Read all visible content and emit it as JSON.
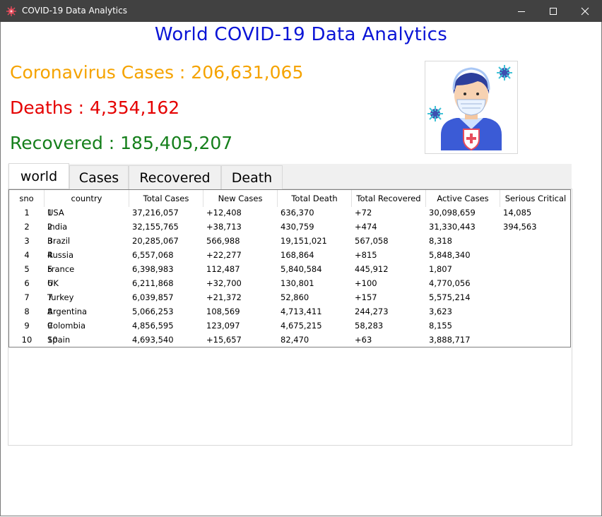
{
  "window": {
    "title": "COVID-19 Data Analytics",
    "icon": "virus-icon",
    "controls": [
      "minimize-icon",
      "maximize-icon",
      "close-icon"
    ]
  },
  "header": {
    "title": "World COVID-19 Data Analytics"
  },
  "stats": {
    "cases_text": "Coronavirus Cases : 206,631,065",
    "deaths_text": "Deaths : 4,354,162",
    "recovered_text": "Recovered : 185,405,207"
  },
  "image": {
    "icon": "masked-person-icon"
  },
  "tabs": [
    {
      "label": "world"
    },
    {
      "label": "Cases"
    },
    {
      "label": "Recovered"
    },
    {
      "label": "Death"
    }
  ],
  "table": {
    "columns": [
      "sno",
      "country",
      "Total Cases",
      "New Cases",
      "Total Death",
      "Total Recovered",
      "Active Cases",
      "Serious Critical"
    ],
    "rows": [
      {
        "index": "1",
        "sno": "1",
        "country": "USA",
        "total_cases": "37,216,057",
        "new_cases": "+12,408",
        "total_death": "636,370",
        "total_recovered": "+72",
        "active_cases": "30,098,659",
        "serious_critical": "14,085"
      },
      {
        "index": "2",
        "sno": "2",
        "country": "India",
        "total_cases": "32,155,765",
        "new_cases": "+38,713",
        "total_death": "430,759",
        "total_recovered": "+474",
        "active_cases": "31,330,443",
        "serious_critical": "394,563"
      },
      {
        "index": "3",
        "sno": "3",
        "country": "Brazil",
        "total_cases": "20,285,067",
        "new_cases": "566,988",
        "total_death": "19,151,021",
        "total_recovered": "567,058",
        "active_cases": "8,318",
        "serious_critical": ""
      },
      {
        "index": "4",
        "sno": "4",
        "country": "Russia",
        "total_cases": "6,557,068",
        "new_cases": "+22,277",
        "total_death": "168,864",
        "total_recovered": "+815",
        "active_cases": "5,848,340",
        "serious_critical": ""
      },
      {
        "index": "5",
        "sno": "5",
        "country": "France",
        "total_cases": "6,398,983",
        "new_cases": "112,487",
        "total_death": "5,840,584",
        "total_recovered": "445,912",
        "active_cases": "1,807",
        "serious_critical": ""
      },
      {
        "index": "6",
        "sno": "6",
        "country": "UK",
        "total_cases": "6,211,868",
        "new_cases": "+32,700",
        "total_death": "130,801",
        "total_recovered": "+100",
        "active_cases": "4,770,056",
        "serious_critical": ""
      },
      {
        "index": "7",
        "sno": "7",
        "country": "Turkey",
        "total_cases": "6,039,857",
        "new_cases": "+21,372",
        "total_death": "52,860",
        "total_recovered": "+157",
        "active_cases": "5,575,214",
        "serious_critical": ""
      },
      {
        "index": "8",
        "sno": "8",
        "country": "Argentina",
        "total_cases": "5,066,253",
        "new_cases": "108,569",
        "total_death": "4,713,411",
        "total_recovered": "244,273",
        "active_cases": "3,623",
        "serious_critical": ""
      },
      {
        "index": "9",
        "sno": "9",
        "country": "Colombia",
        "total_cases": "4,856,595",
        "new_cases": "123,097",
        "total_death": "4,675,215",
        "total_recovered": "58,283",
        "active_cases": "8,155",
        "serious_critical": ""
      },
      {
        "index": "10",
        "sno": "10",
        "country": "Spain",
        "total_cases": "4,693,540",
        "new_cases": "+15,657",
        "total_death": "82,470",
        "total_recovered": "+63",
        "active_cases": "3,888,717",
        "serious_critical": ""
      }
    ]
  },
  "colors": {
    "title": "#0a14d6",
    "cases": "#f5a300",
    "deaths": "#e50000",
    "recovered": "#157f1b",
    "titlebar": "#414141"
  }
}
